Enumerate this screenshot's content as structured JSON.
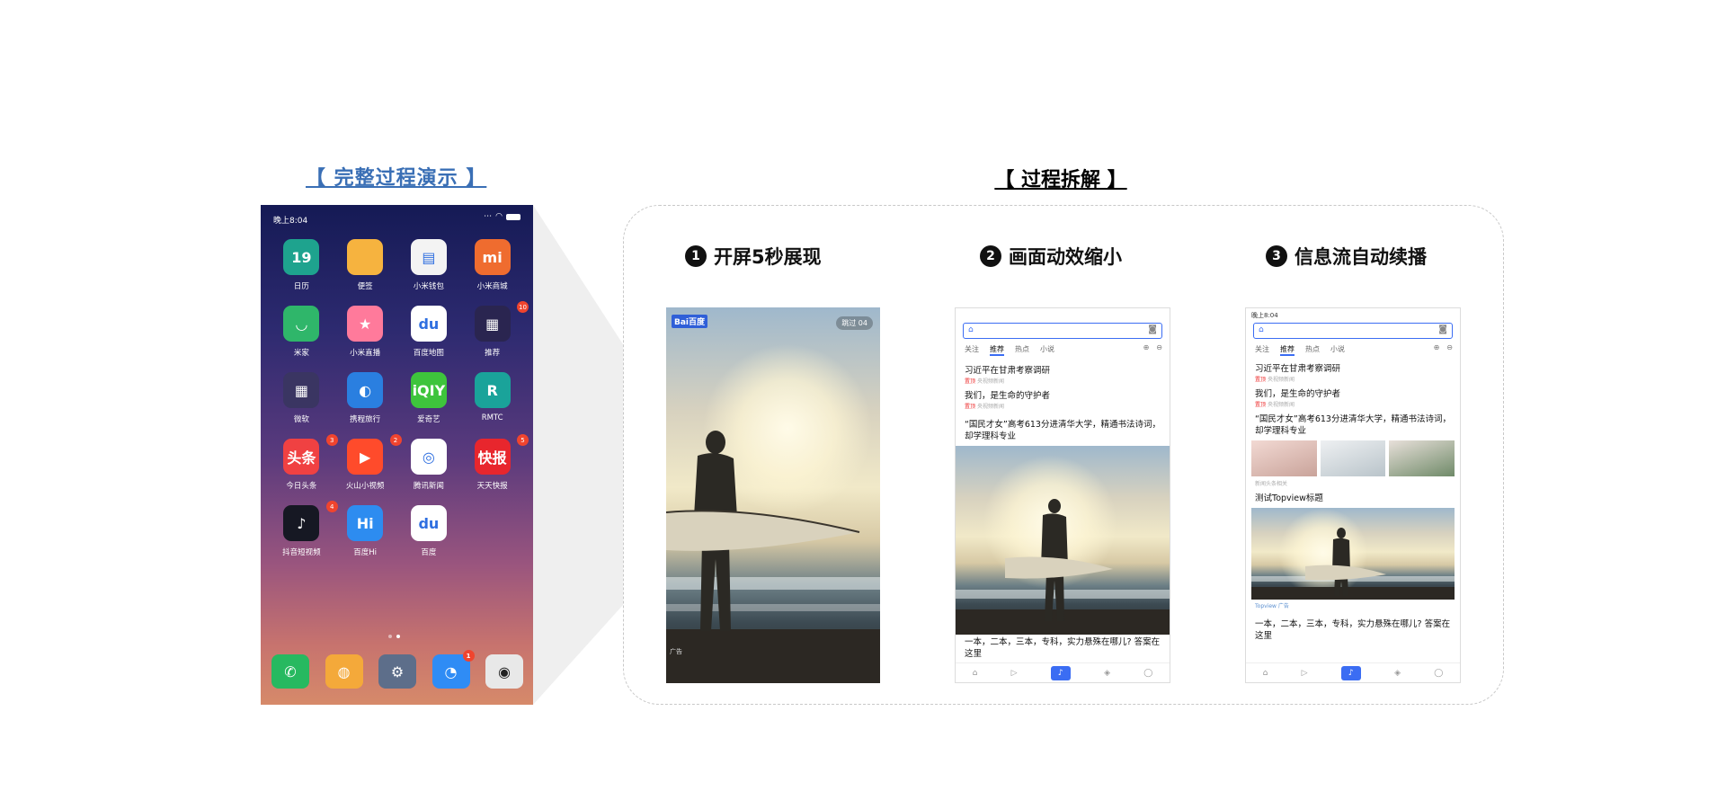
{
  "headings": {
    "left": "【 完整过程演示 】",
    "right": "【 过程拆解 】"
  },
  "phone": {
    "time": "晚上8:04",
    "apps": [
      {
        "label": "日历",
        "glyph": "19",
        "color": "#1ea38e",
        "badge": ""
      },
      {
        "label": "便签",
        "glyph": "",
        "color": "#f6b33f",
        "badge": ""
      },
      {
        "label": "小米钱包",
        "glyph": "▤",
        "color": "#f3f3f3",
        "badge": ""
      },
      {
        "label": "小米商城",
        "glyph": "mi",
        "color": "#ef6c2f",
        "badge": ""
      },
      {
        "label": "米家",
        "glyph": "◡",
        "color": "#2fb66a",
        "badge": ""
      },
      {
        "label": "小米直播",
        "glyph": "★",
        "color": "#ff7a9b",
        "badge": ""
      },
      {
        "label": "百度地图",
        "glyph": "du",
        "color": "#ffffff",
        "badge": ""
      },
      {
        "label": "推荐",
        "glyph": "▦",
        "color": "#2a2550",
        "badge": "10"
      },
      {
        "label": "微软",
        "glyph": "▦",
        "color": "#3a3562",
        "badge": ""
      },
      {
        "label": "携程旅行",
        "glyph": "◐",
        "color": "#2a7fe0",
        "badge": ""
      },
      {
        "label": "爱奇艺",
        "glyph": "iQIY",
        "color": "#3ec43c",
        "badge": ""
      },
      {
        "label": "RMTC",
        "glyph": "R",
        "color": "#1aa39a",
        "badge": ""
      },
      {
        "label": "今日头条",
        "glyph": "头条",
        "color": "#f04142",
        "badge": "3"
      },
      {
        "label": "火山小视频",
        "glyph": "▶",
        "color": "#ff4b2b",
        "badge": "2"
      },
      {
        "label": "腾讯新闻",
        "glyph": "◎",
        "color": "#ffffff",
        "badge": ""
      },
      {
        "label": "天天快报",
        "glyph": "快报",
        "color": "#e8262d",
        "badge": "5"
      },
      {
        "label": "抖音短视频",
        "glyph": "♪",
        "color": "#161823",
        "badge": "4"
      },
      {
        "label": "百度Hi",
        "glyph": "Hi",
        "color": "#2d8cf0",
        "badge": ""
      },
      {
        "label": "百度",
        "glyph": "du",
        "color": "#ffffff",
        "badge": ""
      }
    ],
    "dock": [
      {
        "glyph": "✆",
        "color": "#27b960",
        "badge": ""
      },
      {
        "glyph": "◍",
        "color": "#f4a93a",
        "badge": ""
      },
      {
        "glyph": "⚙",
        "color": "#5d6e8a",
        "badge": ""
      },
      {
        "glyph": "◔",
        "color": "#2f8cf5",
        "badge": "1"
      },
      {
        "glyph": "◉",
        "color": "#e8e8e8",
        "badge": ""
      }
    ]
  },
  "steps": [
    {
      "num": "1",
      "label": "开屏5秒展现"
    },
    {
      "num": "2",
      "label": "画面动效缩小"
    },
    {
      "num": "3",
      "label": "信息流自动续播"
    }
  ],
  "splash": {
    "logo": "Bai百度",
    "skip": "跳过 04",
    "ad_tag": "广告"
  },
  "feed": {
    "time": "晚上8:04",
    "tabs": [
      "关注",
      "推荐",
      "热点",
      "小说"
    ],
    "headline1": "习近平在甘肃考察调研",
    "headline2": "我们，是生命的守护者",
    "headline3": "“国民才女”高考613分进清华大学，精通书法诗词，却学理科专业",
    "source": "央视频新闻",
    "source_tag": "置顶",
    "topview_title": "测试Topview标题",
    "topview_meta": "Topview 广告",
    "news4": "一本，二本，三本，专科，实力悬殊在哪儿? 答案在这里",
    "thumb_caption": "新闻头条相关"
  },
  "tabbar": [
    "首页",
    "好看视频",
    "",
    "小游戏",
    "未登录"
  ]
}
